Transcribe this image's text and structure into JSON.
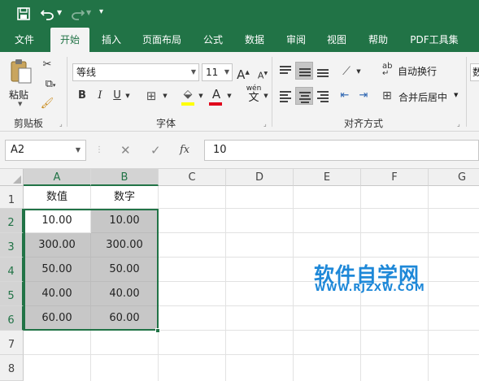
{
  "quick_access": {
    "save_icon": "save-icon",
    "undo_icon": "undo-icon",
    "redo_icon": "redo-icon",
    "customize_icon": "customize-icon"
  },
  "tabs": [
    {
      "label": "文件",
      "active": false
    },
    {
      "label": "开始",
      "active": true
    },
    {
      "label": "插入",
      "active": false
    },
    {
      "label": "页面布局",
      "active": false
    },
    {
      "label": "公式",
      "active": false
    },
    {
      "label": "数据",
      "active": false
    },
    {
      "label": "审阅",
      "active": false
    },
    {
      "label": "视图",
      "active": false
    },
    {
      "label": "帮助",
      "active": false
    },
    {
      "label": "PDF工具集",
      "active": false
    }
  ],
  "ribbon": {
    "clipboard": {
      "paste_label": "粘贴",
      "group_label": "剪贴板"
    },
    "font": {
      "font_name": "等线",
      "font_size": "11",
      "bold": "B",
      "italic": "I",
      "underline": "U",
      "grow": "A",
      "shrink": "A",
      "wen": "wén",
      "wen_char": "文",
      "group_label": "字体"
    },
    "alignment": {
      "wrap_text": "自动换行",
      "merge_center": "合并后居中",
      "group_label": "对齐方式"
    },
    "number_partial": "数"
  },
  "formula_bar": {
    "name_box": "A2",
    "cancel": "✕",
    "enter": "✓",
    "fx": "fx",
    "value": "10"
  },
  "columns": [
    "A",
    "B",
    "C",
    "D",
    "E",
    "F",
    "G"
  ],
  "rows": [
    "1",
    "2",
    "3",
    "4",
    "5",
    "6",
    "7",
    "8"
  ],
  "table": {
    "headers": [
      "数值",
      "数字"
    ],
    "rows": [
      [
        "10.00",
        "10.00"
      ],
      [
        "300.00",
        "300.00"
      ],
      [
        "50.00",
        "50.00"
      ],
      [
        "40.00",
        "40.00"
      ],
      [
        "60.00",
        "60.00"
      ]
    ]
  },
  "watermark": {
    "title": "软件自学网",
    "url": "WWW.RJZXW.COM"
  },
  "colors": {
    "accent": "#217346",
    "selection_fill": "#c7c7c7",
    "watermark": "#1e88d8",
    "font_color": "#e0001b",
    "highlight": "#ffff00"
  }
}
